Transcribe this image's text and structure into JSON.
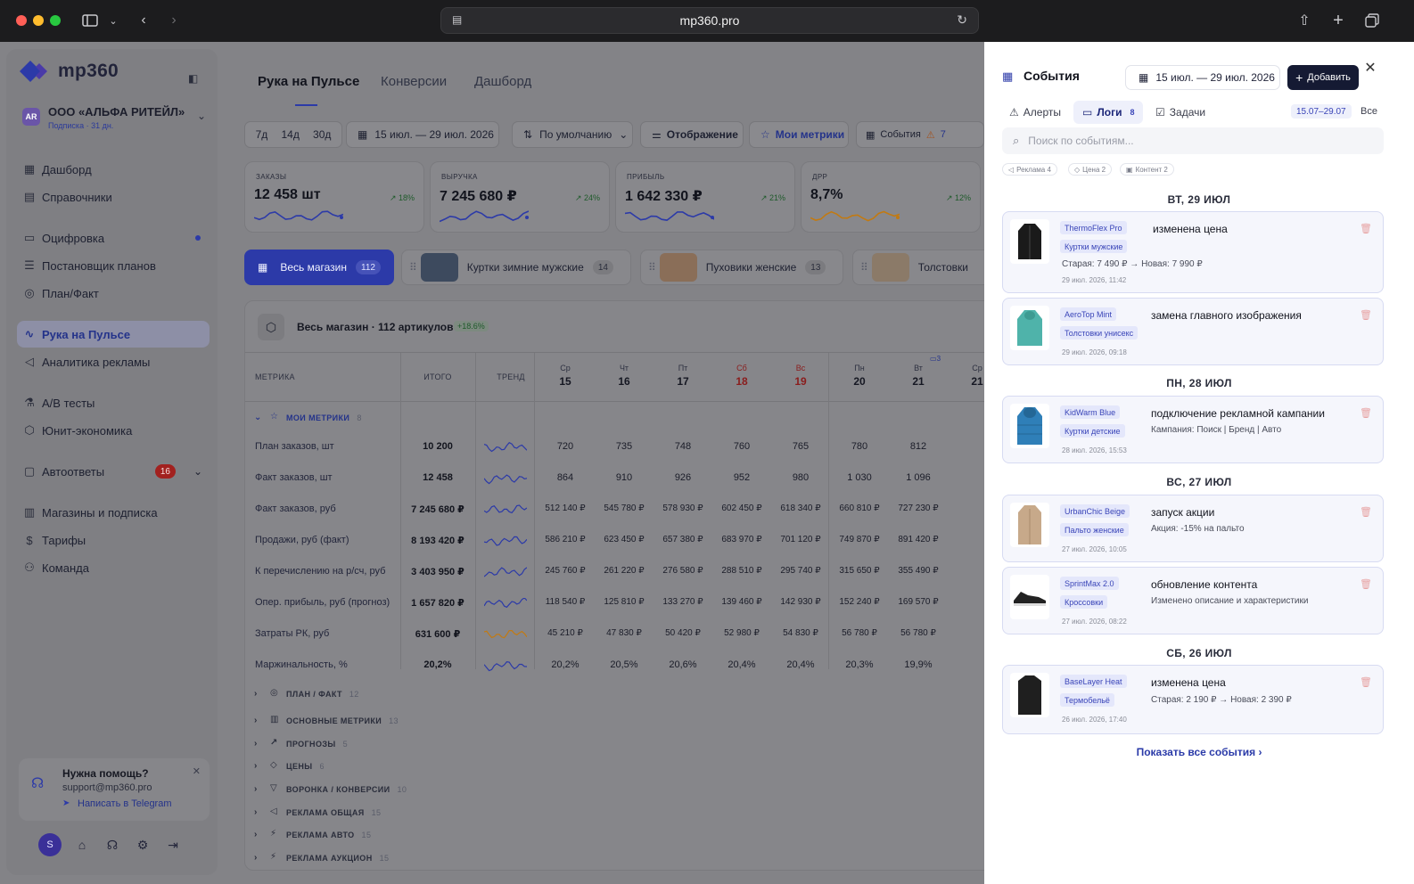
{
  "browser": {
    "url": "mp360.pro"
  },
  "sidebar": {
    "logo": "mp360",
    "org": {
      "badge": "AR",
      "name": "ООО «АЛЬФА РИТЕЙЛ»",
      "subscription": "Подписка · 31 дн."
    },
    "items": [
      {
        "label": "Дашборд",
        "icon": "grid-icon"
      },
      {
        "label": "Справочники",
        "icon": "book-icon"
      },
      {
        "label": "Оцифровка",
        "icon": "folder-icon"
      },
      {
        "label": "Постановщик планов",
        "icon": "list-icon"
      },
      {
        "label": "План/Факт",
        "icon": "target-icon"
      },
      {
        "label": "Рука на Пульсе",
        "icon": "pulse-icon"
      },
      {
        "label": "Аналитика рекламы",
        "icon": "megaphone-icon"
      },
      {
        "label": "А/В тесты",
        "icon": "flask-icon"
      },
      {
        "label": "Юнит-экономика",
        "icon": "cube-icon"
      },
      {
        "label": "Автоответы",
        "icon": "chat-icon",
        "badge": "16"
      },
      {
        "label": "Магазины и подписка",
        "icon": "store-icon"
      },
      {
        "label": "Тарифы",
        "icon": "coin-icon"
      },
      {
        "label": "Команда",
        "icon": "team-icon"
      }
    ],
    "help": {
      "title": "Нужна помощь?",
      "email": "support@mp360.pro",
      "telegram": "Написать в Telegram"
    },
    "avatar": "S"
  },
  "main": {
    "tabs": [
      "Рука на Пульсе",
      "Конверсии",
      "Дашборд"
    ],
    "periods": [
      "7д",
      "14д",
      "30д"
    ],
    "date_range": "15 июл. — 29 июл. 2026",
    "sort": "По умолчанию",
    "display": "Отображение",
    "my_metrics": "Мои метрики",
    "events": "События",
    "events_count": "7",
    "kpis": [
      {
        "label": "ЗАКАЗЫ",
        "value": "12 458 шт",
        "change": "18%",
        "color": "#2c3aa8"
      },
      {
        "label": "ВЫРУЧКА",
        "value": "7 245 680 ₽",
        "change": "24%",
        "color": "#2c3aa8"
      },
      {
        "label": "ПРИБЫЛЬ",
        "value": "1 642 330 ₽",
        "change": "21%",
        "color": "#2c3aa8"
      },
      {
        "label": "ДРР",
        "value": "8,7%",
        "change": "12%",
        "color": "#c27a12"
      }
    ],
    "segments": [
      {
        "label": "Весь магазин",
        "count": "112"
      },
      {
        "label": "Куртки зимние мужские",
        "count": "14"
      },
      {
        "label": "Пуховики женские",
        "count": "13"
      },
      {
        "label": "Толстовки",
        "count": ""
      }
    ],
    "table": {
      "title": "Весь магазин · 112 артикулов",
      "badge": "+18.6%",
      "col_metric": "МЕТРИКА",
      "col_total": "ИТОГО",
      "col_trend": "ТРЕНД",
      "days": [
        {
          "dn": "Ср",
          "dd": "15",
          "we": false
        },
        {
          "dn": "Чт",
          "dd": "16",
          "we": false
        },
        {
          "dn": "Пт",
          "dd": "17",
          "we": false
        },
        {
          "dn": "Сб",
          "dd": "18",
          "we": true
        },
        {
          "dn": "Вс",
          "dd": "19",
          "we": true
        },
        {
          "dn": "Пн",
          "dd": "20",
          "we": false
        },
        {
          "dn": "Вт",
          "dd": "21",
          "we": false
        },
        {
          "dn": "Ср",
          "dd": "21",
          "we": false
        }
      ],
      "day_marker": "3",
      "my_metrics_label": "МОИ МЕТРИКИ",
      "my_metrics_count": "8",
      "rows": [
        {
          "label": "План заказов, шт",
          "total": "10 200",
          "values": [
            "720",
            "735",
            "748",
            "760",
            "765",
            "780",
            "812"
          ],
          "trend": "#2c3aa8"
        },
        {
          "label": "Факт заказов, шт",
          "total": "12 458",
          "values": [
            "864",
            "910",
            "926",
            "952",
            "980",
            "1 030",
            "1 096"
          ],
          "trend": "#2c3aa8"
        },
        {
          "label": "Факт заказов, руб",
          "total": "7 245 680 ₽",
          "values": [
            "512 140 ₽",
            "545 780 ₽",
            "578 930 ₽",
            "602 450 ₽",
            "618 340 ₽",
            "660 810 ₽",
            "727 230 ₽"
          ],
          "trend": "#2c3aa8"
        },
        {
          "label": "Продажи, руб (факт)",
          "total": "8 193 420 ₽",
          "values": [
            "586 210 ₽",
            "623 450 ₽",
            "657 380 ₽",
            "683 970 ₽",
            "701 120 ₽",
            "749 870 ₽",
            "891 420 ₽"
          ],
          "trend": "#2c3aa8"
        },
        {
          "label": "К перечислению на р/сч, руб",
          "total": "3 403 950 ₽",
          "values": [
            "245 760 ₽",
            "261 220 ₽",
            "276 580 ₽",
            "288 510 ₽",
            "295 740 ₽",
            "315 650 ₽",
            "355 490 ₽"
          ],
          "trend": "#2c3aa8"
        },
        {
          "label": "Опер. прибыль, руб (прогноз)",
          "total": "1 657 820 ₽",
          "values": [
            "118 540 ₽",
            "125 810 ₽",
            "133 270 ₽",
            "139 460 ₽",
            "142 930 ₽",
            "152 240 ₽",
            "169 570 ₽"
          ],
          "trend": "#2c3aa8"
        },
        {
          "label": "Затраты РК, руб",
          "total": "631 600 ₽",
          "values": [
            "45 210 ₽",
            "47 830 ₽",
            "50 420 ₽",
            "52 980 ₽",
            "54 830 ₽",
            "56 780 ₽",
            "56 780 ₽"
          ],
          "trend": "#c27a12"
        },
        {
          "label": "Маржинальность, %",
          "total": "20,2%",
          "values": [
            "20,2%",
            "20,5%",
            "20,6%",
            "20,4%",
            "20,4%",
            "20,3%",
            "19,9%"
          ],
          "trend": "#2c3aa8"
        }
      ],
      "groups": [
        {
          "label": "ПЛАН / ФАКТ",
          "count": "12"
        },
        {
          "label": "ОСНОВНЫЕ МЕТРИКИ",
          "count": "13"
        },
        {
          "label": "ПРОГНОЗЫ",
          "count": "5"
        },
        {
          "label": "ЦЕНЫ",
          "count": "6"
        },
        {
          "label": "ВОРОНКА / КОНВЕРСИИ",
          "count": "10"
        },
        {
          "label": "РЕКЛАМА ОБЩАЯ",
          "count": "15"
        },
        {
          "label": "РЕКЛАМА АВТО",
          "count": "15"
        },
        {
          "label": "РЕКЛАМА АУКЦИОН",
          "count": "15"
        }
      ]
    }
  },
  "panel": {
    "title": "События",
    "date_range": "15 июл. — 29 июл. 2026",
    "add": "Добавить",
    "tabs": [
      {
        "label": "Алерты",
        "count": ""
      },
      {
        "label": "Логи",
        "count": "8"
      },
      {
        "label": "Задачи",
        "count": ""
      }
    ],
    "range_chip": "15.07–29.07",
    "all": "Все",
    "search_placeholder": "Поиск по событиям...",
    "chips": [
      "Реклама 4",
      "Цена 2",
      "Контент 2"
    ],
    "days": [
      {
        "label": "ВТ, 29 ИЮЛ"
      },
      {
        "label": "ПН, 28 ИЮЛ"
      },
      {
        "label": "ВС, 27 ИЮЛ"
      },
      {
        "label": "СБ, 26 ИЮЛ"
      }
    ],
    "events": [
      {
        "product": "ThermoFlex Pro",
        "category": "Куртки мужские",
        "title": "изменена цена",
        "old": "Старая: 7 490 ₽",
        "new": "Новая: 7 990 ₽",
        "time": "29 июл. 2026, 11:42",
        "icon": "black-jacket-icon"
      },
      {
        "product": "AeroTop Mint",
        "category": "Толстовки унисекс",
        "title": "замена главного изображения",
        "time": "29 июл. 2026, 09:18",
        "icon": "mint-hoodie-icon"
      },
      {
        "product": "KidWarm Blue",
        "category": "Куртки детские",
        "title": "подключение рекламной кампании",
        "desc": "Кампания: Поиск | Бренд | Авто",
        "time": "28 июл. 2026, 15:53",
        "icon": "blue-jacket-icon"
      },
      {
        "product": "UrbanChic Beige",
        "category": "Пальто женские",
        "title": "запуск акции",
        "desc": "Акция: -15% на пальто",
        "time": "27 июл. 2026, 10:05",
        "icon": "beige-coat-icon"
      },
      {
        "product": "SprintMax 2.0",
        "category": "Кроссовки",
        "title": "обновление контента",
        "desc": "Изменено описание и характеристики",
        "time": "27 июл. 2026, 08:22",
        "icon": "sneaker-icon"
      },
      {
        "product": "BaseLayer Heat",
        "category": "Термобельё",
        "title": "изменена цена",
        "old": "Старая: 2 190 ₽",
        "new": "Новая: 2 390 ₽",
        "time": "26 июл. 2026, 17:40",
        "icon": "thermal-top-icon"
      }
    ],
    "show_all": "Показать все события"
  }
}
